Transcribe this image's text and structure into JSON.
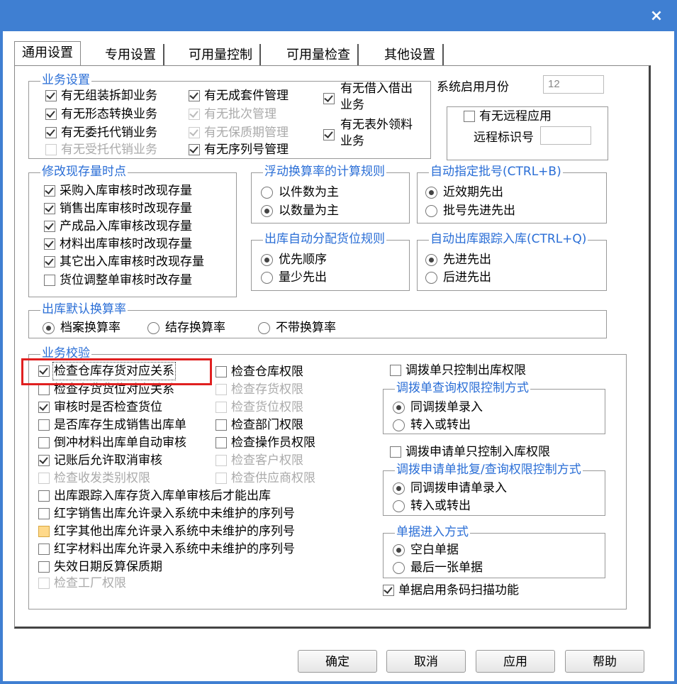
{
  "window": {
    "close_glyph": "×"
  },
  "tabs": [
    "通用设置",
    "专用设置",
    "可用量控制",
    "可用量检查",
    "其他设置"
  ],
  "business_settings": {
    "title": "业务设置",
    "col1": [
      {
        "label": "有无组装拆卸业务",
        "checked": true,
        "disabled": false
      },
      {
        "label": "有无形态转换业务",
        "checked": true,
        "disabled": false
      },
      {
        "label": "有无委托代销业务",
        "checked": true,
        "disabled": false
      },
      {
        "label": "有无受托代销业务",
        "checked": false,
        "disabled": true
      }
    ],
    "col2": [
      {
        "label": "有无成套件管理",
        "checked": true,
        "disabled": false
      },
      {
        "label": "有无批次管理",
        "checked": true,
        "disabled": true
      },
      {
        "label": "有无保质期管理",
        "checked": true,
        "disabled": true
      },
      {
        "label": "有无序列号管理",
        "checked": true,
        "disabled": false
      }
    ],
    "col3": [
      {
        "label_line1": "有无借入借出",
        "label_line2": "业务",
        "checked": true
      },
      {
        "label_line1": "有无表外领料",
        "label_line2": "业务",
        "checked": true
      }
    ]
  },
  "system_start_month": {
    "label": "系统启用月份",
    "value": "12"
  },
  "remote": {
    "checkbox_label": "有无远程应用",
    "checked": false,
    "id_label": "远程标识号",
    "id_value": ""
  },
  "modify_stock_time": {
    "title": "修改现存量时点",
    "items": [
      {
        "label": "采购入库审核时改现存量",
        "checked": true
      },
      {
        "label": "销售出库审核时改现存量",
        "checked": true
      },
      {
        "label": "产成品入库审核改现存量",
        "checked": true
      },
      {
        "label": "材料出库审核时改现存量",
        "checked": true
      },
      {
        "label": "其它出入库审核时改现存量",
        "checked": true
      },
      {
        "label": "货位调整单审核时改存量",
        "checked": false
      }
    ]
  },
  "float_rule": {
    "title": "浮动换算率的计算规则",
    "options": [
      "以件数为主",
      "以数量为主"
    ],
    "selected": 1
  },
  "auto_batch": {
    "title": "自动指定批号(CTRL+B)",
    "options": [
      "近效期先出",
      "批号先进先出"
    ],
    "selected": 0
  },
  "outbound_location": {
    "title": "出库自动分配货位规则",
    "options": [
      "优先顺序",
      "量少先出"
    ],
    "selected": 0
  },
  "auto_trace": {
    "title": "自动出库跟踪入库(CTRL+Q)",
    "options": [
      "先进先出",
      "后进先出"
    ],
    "selected": 0
  },
  "default_rate": {
    "title": "出库默认换算率",
    "options": [
      "档案换算率",
      "结存换算率",
      "不带换算率"
    ],
    "selected": 0
  },
  "business_check": {
    "title": "业务校验",
    "col1": [
      {
        "label": "检查仓库存货对应关系",
        "checked": true,
        "disabled": false
      },
      {
        "label": "检查存货货位对应关系",
        "checked": false,
        "disabled": false
      },
      {
        "label": "审核时是否检查货位",
        "checked": true,
        "disabled": false
      },
      {
        "label": "是否库存生成销售出库单",
        "checked": false,
        "disabled": false
      },
      {
        "label": "倒冲材料出库单自动审核",
        "checked": false,
        "disabled": false
      },
      {
        "label": "记账后允许取消审核",
        "checked": true,
        "disabled": false
      },
      {
        "label": "检查收发类别权限",
        "checked": false,
        "disabled": true
      }
    ],
    "col2": [
      {
        "label": "检查仓库权限",
        "checked": false,
        "disabled": false
      },
      {
        "label": "检查存货权限",
        "checked": false,
        "disabled": true
      },
      {
        "label": "检查货位权限",
        "checked": false,
        "disabled": true
      },
      {
        "label": "检查部门权限",
        "checked": false,
        "disabled": false
      },
      {
        "label": "检查操作员权限",
        "checked": false,
        "disabled": false
      },
      {
        "label": "检查客户权限",
        "checked": false,
        "disabled": true
      },
      {
        "label": "检查供应商权限",
        "checked": false,
        "disabled": true
      }
    ],
    "long": [
      {
        "label": "出库跟踪入库存货入库单审核后才能出库",
        "checked": false,
        "disabled": false
      },
      {
        "label": "红字销售出库允许录入系统中未维护的序列号",
        "checked": false,
        "disabled": false
      },
      {
        "label": "红字其他出库允许录入系统中未维护的序列号",
        "checked": false,
        "disabled": false
      },
      {
        "label": "红字材料出库允许录入系统中未维护的序列号",
        "checked": false,
        "disabled": false
      },
      {
        "label": "失效日期反算保质期",
        "checked": false,
        "disabled": false
      },
      {
        "label": "检查工厂权限",
        "checked": false,
        "disabled": true
      }
    ]
  },
  "transfer_out_only": {
    "label": "调拨单只控制出库权限",
    "checked": false
  },
  "transfer_query": {
    "title": "调拨单查询权限控制方式",
    "options": [
      "同调拨单录入",
      "转入或转出"
    ],
    "selected": 0
  },
  "transfer_apply_in_only": {
    "label": "调拨申请单只控制入库权限",
    "checked": false
  },
  "transfer_apply_query": {
    "title": "调拨申请单批复/查询权限控制方式",
    "options": [
      "同调拨申请单录入",
      "转入或转出"
    ],
    "selected": 0
  },
  "doc_entry": {
    "title": "单据进入方式",
    "options": [
      "空白单据",
      "最后一张单据"
    ],
    "selected": 0
  },
  "barcode": {
    "label": "单据启用条码扫描功能",
    "checked": true
  },
  "buttons": {
    "ok": "确定",
    "cancel": "取消",
    "apply": "应用",
    "help": "帮助"
  }
}
